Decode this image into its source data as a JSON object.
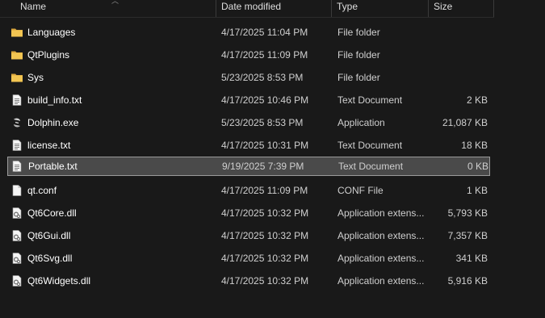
{
  "columns": {
    "name": "Name",
    "date_modified": "Date modified",
    "type": "Type",
    "size": "Size"
  },
  "files": [
    {
      "name": "Languages",
      "date": "4/17/2025 11:04 PM",
      "type": "File folder",
      "size": "",
      "icon": "folder-icon"
    },
    {
      "name": "QtPlugins",
      "date": "4/17/2025 11:09 PM",
      "type": "File folder",
      "size": "",
      "icon": "folder-icon"
    },
    {
      "name": "Sys",
      "date": "5/23/2025 8:53 PM",
      "type": "File folder",
      "size": "",
      "icon": "folder-icon"
    },
    {
      "name": "build_info.txt",
      "date": "4/17/2025 10:46 PM",
      "type": "Text Document",
      "size": "2 KB",
      "icon": "text-document-icon"
    },
    {
      "name": "Dolphin.exe",
      "date": "5/23/2025 8:53 PM",
      "type": "Application",
      "size": "21,087 KB",
      "icon": "dolphin-app-icon"
    },
    {
      "name": "license.txt",
      "date": "4/17/2025 10:31 PM",
      "type": "Text Document",
      "size": "18 KB",
      "icon": "text-document-icon"
    },
    {
      "name": "Portable.txt",
      "date": "9/19/2025 7:39 PM",
      "type": "Text Document",
      "size": "0 KB",
      "icon": "text-document-icon",
      "selected": true
    },
    {
      "name": "qt.conf",
      "date": "4/17/2025 11:09 PM",
      "type": "CONF File",
      "size": "1 KB",
      "icon": "blank-file-icon"
    },
    {
      "name": "Qt6Core.dll",
      "date": "4/17/2025 10:32 PM",
      "type": "Application extens...",
      "size": "5,793 KB",
      "icon": "dll-file-icon"
    },
    {
      "name": "Qt6Gui.dll",
      "date": "4/17/2025 10:32 PM",
      "type": "Application extens...",
      "size": "7,357 KB",
      "icon": "dll-file-icon"
    },
    {
      "name": "Qt6Svg.dll",
      "date": "4/17/2025 10:32 PM",
      "type": "Application extens...",
      "size": "341 KB",
      "icon": "dll-file-icon"
    },
    {
      "name": "Qt6Widgets.dll",
      "date": "4/17/2025 10:32 PM",
      "type": "Application extens...",
      "size": "5,916 KB",
      "icon": "dll-file-icon"
    }
  ],
  "colors": {
    "background": "#191919",
    "selection": "#4a4a4a",
    "folder": "#e8b84a"
  }
}
